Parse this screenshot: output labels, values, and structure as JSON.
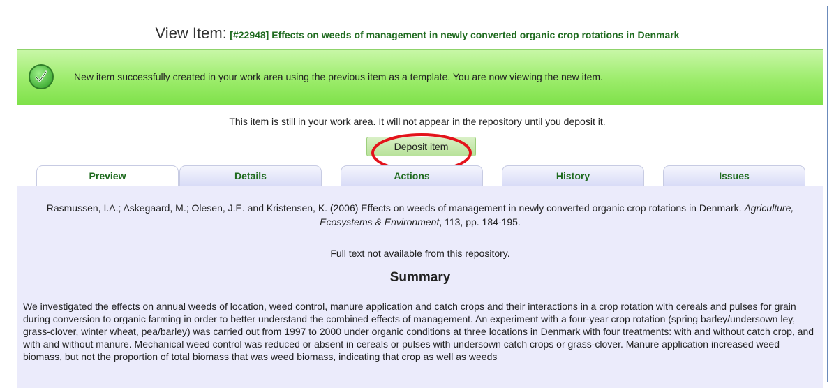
{
  "title": {
    "prefix": "View Item:",
    "text": "[#22948] Effects on weeds of management in newly converted organic crop rotations in Denmark"
  },
  "success": {
    "icon": "checkmark-icon",
    "message": "New item successfully created in your work area using the previous item as a template. You are now viewing the new item."
  },
  "workarea_note": "This item is still in your work area. It will not appear in the repository until you deposit it.",
  "deposit_label": "Deposit item",
  "tabs": [
    {
      "label": "Preview",
      "active": true
    },
    {
      "label": "Details",
      "active": false
    },
    {
      "label": "Actions",
      "active": false
    },
    {
      "label": "History",
      "active": false
    },
    {
      "label": "Issues",
      "active": false
    }
  ],
  "preview": {
    "citation_authors": "Rasmussen, I.A.; Askegaard, M.; Olesen, J.E. and Kristensen, K. (2006) Effects on weeds of management in newly converted organic crop rotations in Denmark.",
    "citation_journal": "Agriculture, Ecosystems & Environment",
    "citation_tail": ", 113, pp. 184-195.",
    "fulltext_note": "Full text not available from this repository.",
    "summary_heading": "Summary",
    "abstract": "We investigated the effects on annual weeds of location, weed control, manure application and catch crops and their interactions in a crop rotation with cereals and pulses for grain during conversion to organic farming in order to better understand the combined effects of management. An experiment with a four-year crop rotation (spring barley/undersown ley, grass-clover, winter wheat, pea/barley) was carried out from 1997 to 2000 under organic conditions at three locations in Denmark with four treatments: with and without catch crop, and with and without manure. Mechanical weed control was reduced or absent in cereals or pulses with undersown catch crops or grass-clover. Manure application increased weed biomass, but not the proportion of total biomass that was weed biomass, indicating that crop as well as weeds"
  },
  "colors": {
    "accent_green": "#1f6b1f",
    "success_green": "#9cec6b",
    "panel_lavender": "#ebebfb",
    "highlight_red": "#e3131b"
  }
}
